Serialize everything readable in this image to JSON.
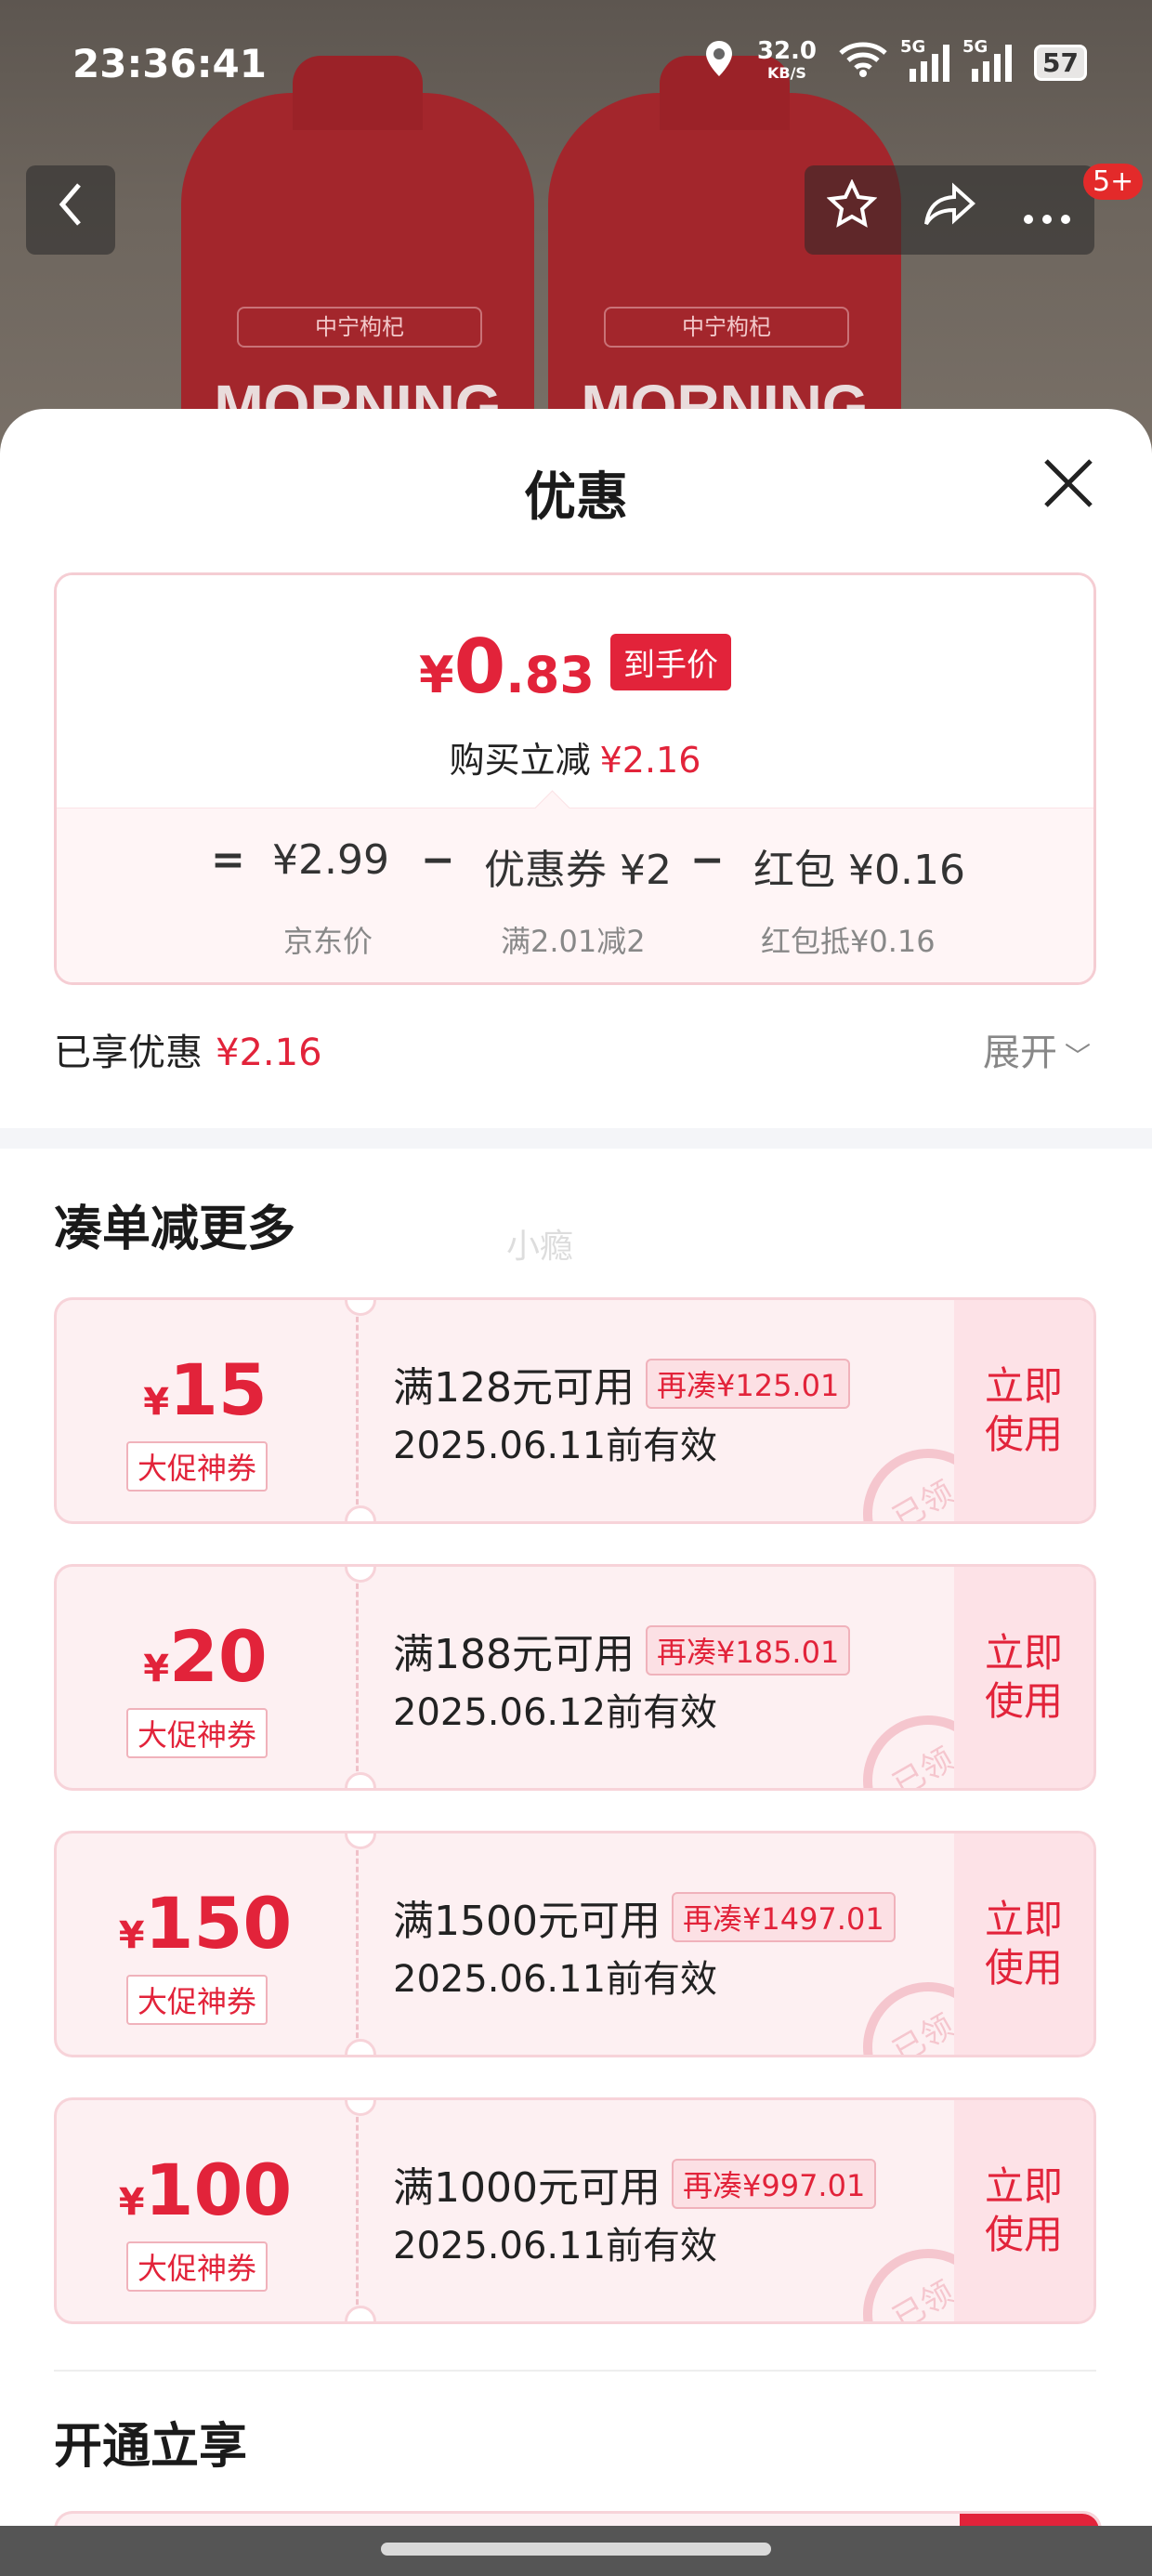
{
  "status_bar": {
    "time": "23:36:41",
    "net_speed": "32.0",
    "net_unit": "KB/S",
    "sig1": "5G",
    "sig2": "5G",
    "battery": "57"
  },
  "hero": {
    "bottle_label": "中宁枸杞",
    "bottle_text": "MORNING",
    "cart_badge": "5+"
  },
  "sheet": {
    "title": "优惠",
    "price": {
      "currency": "¥",
      "final_int": "0",
      "final_dec": ".83",
      "final_tag": "到手价",
      "reduce_label": "购买立减",
      "reduce_value": "¥2.16",
      "eq": "=",
      "minus": "−",
      "jd_price": "¥2.99",
      "jd_label": "京东价",
      "coupon_text": "优惠券 ¥2",
      "coupon_label": "满2.01减2",
      "redpack_text": "红包 ¥0.16",
      "redpack_label": "红包抵¥0.16"
    },
    "enjoyed_label": "已享优惠",
    "enjoyed_value": "¥2.16",
    "expand_label": "展开",
    "section_more": "凑单减更多",
    "watermark": "小瘾",
    "coupons": [
      {
        "symbol": "¥",
        "amount": "15",
        "type": "大促神券",
        "condition": "满128元可用",
        "extra": "再凑¥125.01",
        "valid": "2025.06.11前有效",
        "stamp": "已领",
        "use": "立即使用"
      },
      {
        "symbol": "¥",
        "amount": "20",
        "type": "大促神券",
        "condition": "满188元可用",
        "extra": "再凑¥185.01",
        "valid": "2025.06.12前有效",
        "stamp": "已领",
        "use": "立即使用"
      },
      {
        "symbol": "¥",
        "amount": "150",
        "type": "大促神券",
        "condition": "满1500元可用",
        "extra": "再凑¥1497.01",
        "valid": "2025.06.11前有效",
        "stamp": "已领",
        "use": "立即使用"
      },
      {
        "symbol": "¥",
        "amount": "100",
        "type": "大促神券",
        "condition": "满1000元可用",
        "extra": "再凑¥997.01",
        "valid": "2025.06.11前有效",
        "stamp": "已领",
        "use": "立即使用"
      }
    ],
    "section_open": "开通立享"
  },
  "colors": {
    "accent": "#e2233a",
    "coupon_bg": "#fdf0f2"
  },
  "icons": [
    "back-icon",
    "star-icon",
    "share-icon",
    "more-icon",
    "close-icon",
    "chevron-down-icon",
    "location-icon",
    "wifi-icon"
  ]
}
